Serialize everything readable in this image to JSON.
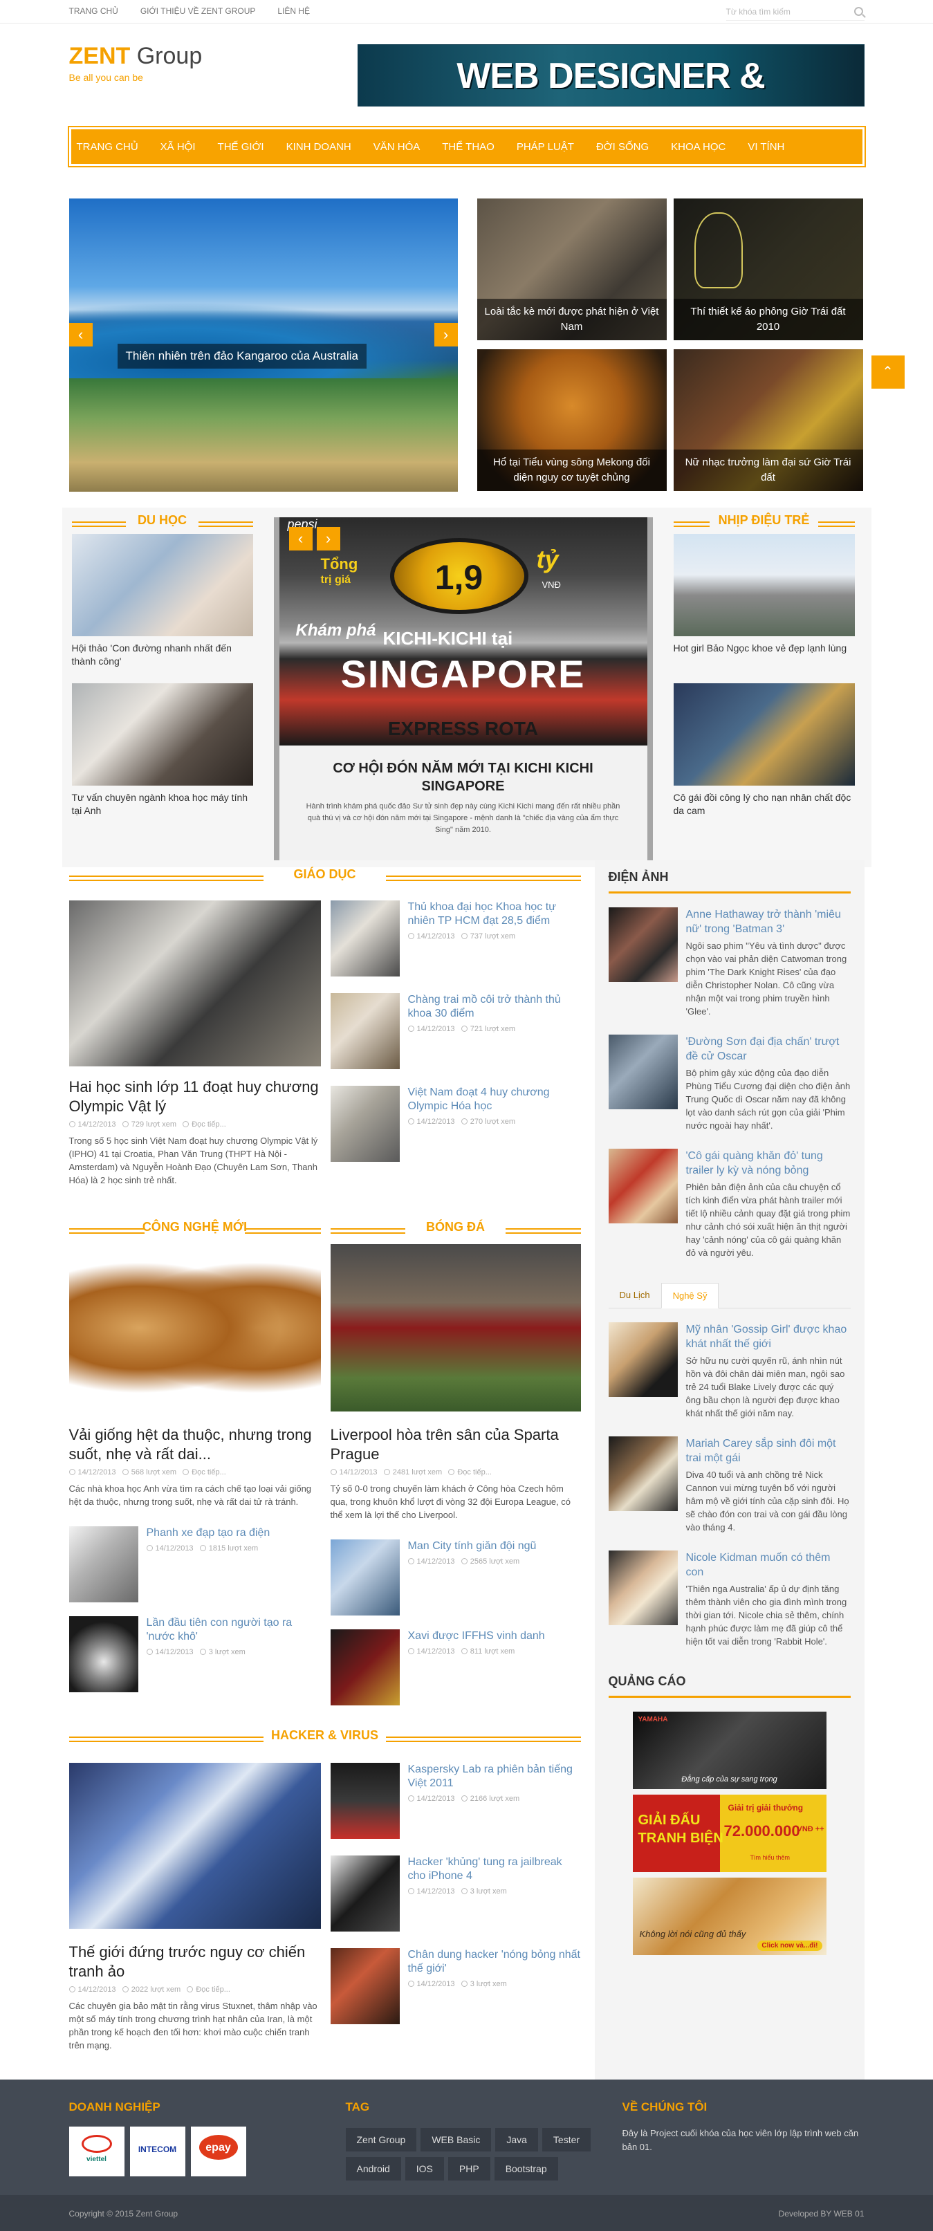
{
  "topnav": [
    "TRANG CHỦ",
    "GIỚI THIỆU VỀ ZENT GROUP",
    "LIÊN HỆ"
  ],
  "search_placeholder": "Từ khóa tìm kiếm",
  "logo": {
    "brand": "ZENT",
    "rest": "Group",
    "slogan": "Be all you can be"
  },
  "banner": "WEB DESIGNER & DEVELOPER",
  "mainnav": [
    "TRANG CHỦ",
    "XÃ HỘI",
    "THẾ GIỚI",
    "KINH DOANH",
    "VĂN HÓA",
    "THỂ THAO",
    "PHÁP LUẬT",
    "ĐỜI SỐNG",
    "KHOA HỌC",
    "VI TÍNH"
  ],
  "hero": {
    "main": "Thiên nhiên trên đảo Kangaroo của Australia",
    "tiles": [
      "Loài tắc kè mới được phát hiện ở Việt Nam",
      "Thí thiết kế áo phông Giờ Trái đất 2010",
      "Hổ tại Tiểu vùng sông Mekong đối diện nguy cơ tuyệt chủng",
      "Nữ nhạc trưởng làm đại sứ Giờ Trái đất"
    ]
  },
  "feat": {
    "duhoc": {
      "title": "DU HỌC",
      "items": [
        "Hội thảo 'Con đường nhanh nhất đến thành công'",
        "Tư vấn chuyên ngành khoa học máy tính tại Anh"
      ]
    },
    "center": {
      "title": "CƠ HỘI ĐÓN NĂM MỚI TẠI KICHI KICHI SINGAPORE",
      "text": "Hành trình khám phá quốc đảo Sư tử sinh đẹp này cùng Kichi Kichi mang đến rất nhiều phần quà thú vị và cơ hội đón năm mới tại Singapore - mệnh danh là \"chiếc địa vàng của ẩm thực Sing\" năm 2010.",
      "img_top": "pepsi",
      "img_val": "1,9",
      "img_unit": "tỷ",
      "img_l1": "Tổng",
      "img_l2": "trị giá",
      "img_l3": "VNĐ",
      "img_k": "Khám phá",
      "img_kk": "KICHI-KICHI tại",
      "img_sg": "SINGAPORE",
      "img_ex": "EXPRESS ROTA"
    },
    "nhipdieu": {
      "title": "NHỊP ĐIỆU TRẺ",
      "items": [
        "Hot girl Bảo Ngọc khoe vẻ đẹp lạnh lùng",
        "Cô gái đồi công lý cho nạn nhân chất độc da cam"
      ]
    }
  },
  "giaoduc": {
    "title": "GIÁO DỤC",
    "main": {
      "title": "Hai học sinh lớp 11 đoạt huy chương Olympic Vật lý",
      "date": "14/12/2013",
      "views": "729 lượt xem",
      "more": "Đọc tiếp...",
      "text": "Trong số 5 học sinh Việt Nam đoạt huy chương Olympic Vật lý (IPHO) 41 tại Croatia, Phan Văn Trung (THPT Hà Nội - Amsterdam) và Nguyễn Hoành Đạo (Chuyên Lam Sơn, Thanh Hóa) là 2 học sinh trẻ nhất."
    },
    "list": [
      {
        "t": "Thủ khoa đại học Khoa học tự nhiên TP HCM đạt 28,5 điểm",
        "d": "14/12/2013",
        "v": "737 lượt xem"
      },
      {
        "t": "Chàng trai mồ côi trở thành thủ khoa 30 điểm",
        "d": "14/12/2013",
        "v": "721 lượt xem"
      },
      {
        "t": "Việt Nam đoạt 4 huy chương Olympic Hóa học",
        "d": "14/12/2013",
        "v": "270 lượt xem"
      }
    ]
  },
  "congnghe": {
    "title": "CÔNG NGHỆ MỚI",
    "main": {
      "title": "Vải giống hệt da thuộc, nhưng trong suốt, nhẹ và rất dai...",
      "date": "14/12/2013",
      "views": "568 lượt xem",
      "more": "Đọc tiếp...",
      "text": "Các nhà khoa học Anh vừa tìm ra cách chế tạo loại vải giống hệt da thuộc, nhưng trong suốt, nhẹ và rất dai tử rà tránh."
    },
    "list": [
      {
        "t": "Phanh xe đạp tạo ra điện",
        "d": "14/12/2013",
        "v": "1815 lượt xem"
      },
      {
        "t": "Lần đầu tiên con người tạo ra 'nước khô'",
        "d": "14/12/2013",
        "v": "3 lượt xem"
      }
    ]
  },
  "bongda": {
    "title": "BÓNG ĐÁ",
    "main": {
      "title": "Liverpool hòa trên sân của Sparta Prague",
      "date": "14/12/2013",
      "views": "2481 lượt xem",
      "more": "Đọc tiếp...",
      "text": "Tỷ số 0-0 trong chuyến làm khách ở Công hòa Czech hôm qua, trong khuôn khổ lượt đi vòng 32 đội Europa League, có thể xem là lợi thế cho Liverpool."
    },
    "list": [
      {
        "t": "Man City tính giăn đội ngũ",
        "d": "14/12/2013",
        "v": "2565 lượt xem"
      },
      {
        "t": "Xavi được IFFHS vinh danh",
        "d": "14/12/2013",
        "v": "811 lượt xem"
      }
    ]
  },
  "hacker": {
    "title": "HACKER & VIRUS",
    "main": {
      "title": "Thế giới đứng trước nguy cơ chiến tranh ảo",
      "date": "14/12/2013",
      "views": "2022 lượt xem",
      "more": "Đọc tiếp...",
      "text": "Các chuyên gia bảo mật tin rằng virus Stuxnet, thâm nhập vào một số máy tính trong chương trình hạt nhân của Iran, là một phần trong kế hoạch đen tối hơn: khơi mào cuộc chiến tranh trên mạng."
    },
    "list": [
      {
        "t": "Kaspersky Lab ra phiên bản tiếng Việt 2011",
        "d": "14/12/2013",
        "v": "2166 lượt xem"
      },
      {
        "t": "Hacker 'khủng' tung ra jailbreak cho iPhone 4",
        "d": "14/12/2013",
        "v": "3 lượt xem"
      },
      {
        "t": "Chân dung hacker 'nóng bỏng nhất thế giới'",
        "d": "14/12/2013",
        "v": "3 lượt xem"
      }
    ]
  },
  "sidebar": {
    "dienanh": {
      "title": "ĐIỆN ẢNH",
      "items": [
        {
          "t": "Anne Hathaway trở thành 'miêu nữ' trong 'Batman 3'",
          "x": "Ngôi sao phim \"Yêu và tình dược\" được chọn vào vai phản diện Catwoman trong phim 'The Dark Knight Rises' của đạo diễn Christopher Nolan. Cô cũng vừa nhận một vai trong phim truyền hình 'Glee'."
        },
        {
          "t": "'Đường Sơn đại địa chấn' trượt đề cử Oscar",
          "x": "Bộ phim gây xúc động của đạo diễn Phùng Tiểu Cương đại diện cho điện ảnh Trung Quốc dì Oscar năm nay đã không lọt vào danh sách rút gọn của giải 'Phim nước ngoài hay nhất'."
        },
        {
          "t": "'Cô gái quàng khăn đỏ' tung trailer ly kỳ và nóng bỏng",
          "x": "Phiên bản điện ảnh của câu chuyện cổ tích kinh điển vừa phát hành trailer mới tiết lộ nhiều cảnh quay đặt giá trong phim như cảnh chó sói xuất hiện ăn thịt người hay 'cảnh nóng' của cô gái quàng khăn đỏ và người yêu."
        }
      ]
    },
    "tabs": [
      "Du Lịch",
      "Nghệ Sỹ"
    ],
    "nghesy": [
      {
        "t": "Mỹ nhân 'Gossip Girl' được khao khát nhất thế giới",
        "x": "Sở hữu nụ cười quyến rũ, ánh nhìn nút hồn và đôi chân dài miên man, ngôi sao trẻ 24 tuổi Blake Lively được các quý ông bầu chọn là người đẹp được khao khát nhất thế giới năm nay."
      },
      {
        "t": "Mariah Carey sắp sinh đôi một trai một gái",
        "x": "Diva 40 tuổi và anh chồng trẻ Nick Cannon vui mừng tuyên bố với người hâm mộ về giới tính của cặp sinh đôi. Họ sẽ chào đón con trai và con gái đầu lòng vào tháng 4."
      },
      {
        "t": "Nicole Kidman muốn có thêm con",
        "x": "'Thiên nga Australia' ấp ủ dự định tăng thêm thành viên cho gia đình mình trong thời gian tới. Nicole chia sẻ thêm, chính hạnh phúc được làm mẹ đã giúp cô thể hiện tốt vai diễn trong 'Rabbit Hole'."
      }
    ],
    "quangcao": "QUẢNG CÁO",
    "ads": [
      {
        "brand": "YAMAHA",
        "line": "Đẳng cấp của sự sang trọng"
      },
      {
        "l1": "GIẢI ĐẤU",
        "l2": "TRANH BIỆN",
        "p": "Giải trị giải thưởng",
        "v": "72.000.000",
        "u": "VNĐ ++",
        "s": "Tìm hiểu thêm"
      },
      {
        "l1": "Không lời nói cũng đủ thấy",
        "btn": "Click now và...đi!"
      }
    ]
  },
  "footer": {
    "col1": "DOANH NGHIỆP",
    "logos": [
      "viettel",
      "INTECOM",
      "epay"
    ],
    "col2": "TAG",
    "tags": [
      "Zent Group",
      "WEB Basic",
      "Java",
      "Tester",
      "Android",
      "IOS",
      "PHP",
      "Bootstrap"
    ],
    "col3": "VỀ CHÚNG TÔI",
    "about": "Đây là Project cuối khóa của học viên lớp lập trình web căn bản 01.",
    "copy": "Copyright © 2015 Zent Group",
    "dev": "Developed BY WEB 01"
  }
}
